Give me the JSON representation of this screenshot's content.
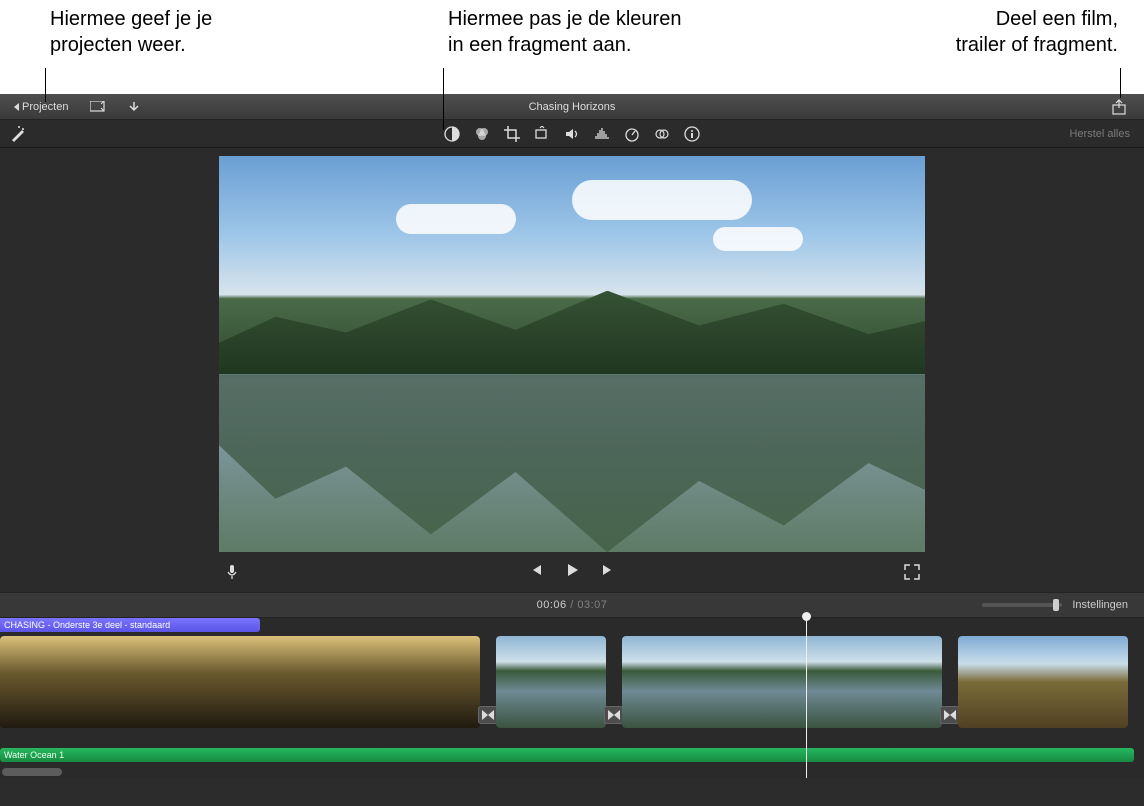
{
  "callouts": {
    "projects": [
      "Hiermee geef je je",
      "projecten weer."
    ],
    "color": [
      "Hiermee pas je de kleuren",
      "in een fragment aan."
    ],
    "share": [
      "Deel een film,",
      "trailer of fragment."
    ]
  },
  "titlebar": {
    "projects_label": "Projecten",
    "project_title": "Chasing Horizons"
  },
  "adjustbar": {
    "reset_label": "Herstel alles",
    "icons": {
      "wand": "magic-wand-icon",
      "color_balance": "color-balance-icon",
      "color_correct": "color-correct-icon",
      "crop": "crop-icon",
      "stabilize": "stabilize-icon",
      "volume": "volume-icon",
      "noise": "noise-reduction-icon",
      "speed": "speed-icon",
      "filter": "filter-icon",
      "info": "info-icon"
    }
  },
  "time": {
    "current": "00:06",
    "sep": " / ",
    "duration": "03:07",
    "settings_label": "Instellingen"
  },
  "title_clip_label": "CHASING - Onderste 3e deel - standaard",
  "audio_clip_label": "Water Ocean 1",
  "timeline": {
    "clips": [
      {
        "thumbs": 4,
        "kind": "sunset",
        "transition_after": true
      },
      {
        "thumbs": 1,
        "kind": "mtn",
        "transition_after": true
      },
      {
        "thumbs": 3,
        "kind": "mtn",
        "transition_after": true
      },
      {
        "thumbs": 2,
        "kind": "rock",
        "transition_after": false
      }
    ]
  }
}
